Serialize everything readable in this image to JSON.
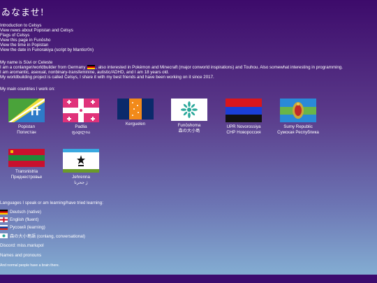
{
  "title": "ゐなませ!",
  "links": [
    "Introduction to Celsys",
    "View news about Popistan and Celsys",
    "Flags of Celsys",
    "View this page in Funōsho",
    "View the time in Popistan",
    "View the date in Funorakiya (script by Manticr0n)"
  ],
  "intro": {
    "line1": "My name is Süvi or Celeste",
    "line2_pre": "I am a conlanger/worldbuilder from Germany",
    "line2_post": ", also interested in Pokémon and Minecraft (major conworld inspirations) and Touhou. Also somewhat interesting in programming.",
    "line3": "I am aromantic, asexual, nonbinary-transfeminine, autistic/ADHD, and I am 18 years old.",
    "line4": "My worldbuilding project is called Celsys, I share it with my best friends and have been working on it since 2017."
  },
  "countries_heading": "My main countries I work on:",
  "countries": [
    {
      "name": "Popistan",
      "native": "Попистан"
    },
    {
      "name": "Padlia",
      "native": "ფადლია"
    },
    {
      "name": "Kerguelen",
      "native": ""
    },
    {
      "name": "Funōshoma",
      "native": "森の大小島"
    },
    {
      "name": "UPR Novorossiya",
      "native": "СНР Новороссия"
    },
    {
      "name": "Sumy Republic",
      "native": "Сумская Республика"
    },
    {
      "name": "Transnistria",
      "native": "Приднестровье"
    },
    {
      "name": "Jehrenna",
      "native": "ژ جحرنا"
    }
  ],
  "languages_heading": "Languages I speak or am learning/have tried learning:",
  "languages": [
    {
      "label": "Deutsch (native)"
    },
    {
      "label": "English (fluent)"
    },
    {
      "label": "Русский (learning)"
    },
    {
      "label": "森の大小島語 (conlang, conversational)"
    }
  ],
  "discord": "Discord: miss.mariupol",
  "names_pronouns": "Names and pronouns",
  "footer_note": "And normal people have a brain there."
}
